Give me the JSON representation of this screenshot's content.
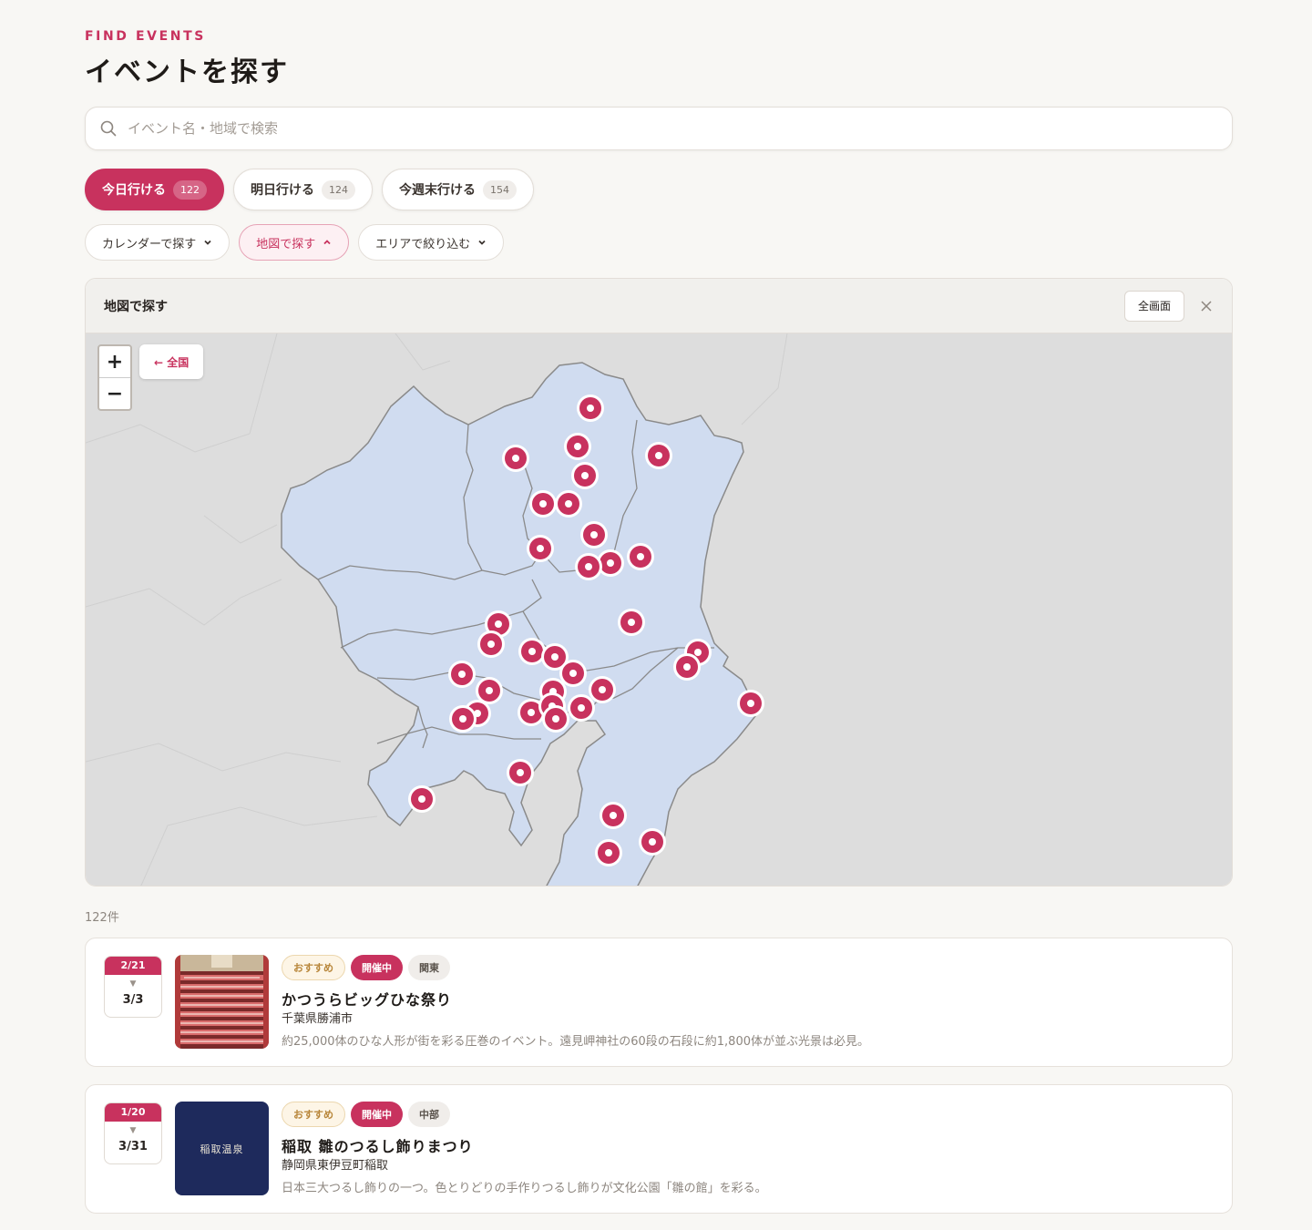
{
  "header": {
    "eyebrow": "FIND EVENTS",
    "title": "イベントを探す"
  },
  "search": {
    "placeholder": "イベント名・地域で検索",
    "icon": "search-icon"
  },
  "day_tabs": [
    {
      "label": "今日行ける",
      "count": "122",
      "active": true
    },
    {
      "label": "明日行ける",
      "count": "124",
      "active": false
    },
    {
      "label": "今週末行ける",
      "count": "154",
      "active": false
    }
  ],
  "filters": [
    {
      "label": "カレンダーで探す",
      "icon": "chevron-down-icon",
      "active": false
    },
    {
      "label": "地図で探す",
      "icon": "chevron-up-icon",
      "active": true
    },
    {
      "label": "エリアで絞り込む",
      "icon": "chevron-down-icon",
      "active": false
    }
  ],
  "map_panel": {
    "title": "地図で探す",
    "fullscreen_label": "全画面",
    "close_icon": "close-icon",
    "zoom_in": "+",
    "zoom_out": "−",
    "back_label": "← 全国"
  },
  "result_count": "122件",
  "events": [
    {
      "date_from": "2/21",
      "date_to": "3/3",
      "tags": [
        "おすすめ",
        "開催中",
        "関東"
      ],
      "title": "かつうらビッグひな祭り",
      "place": "千葉県勝浦市",
      "desc": "約25,000体のひな人形が街を彩る圧巻のイベント。遠見岬神社の60段の石段に約1,800体が並ぶ光景は必見。"
    },
    {
      "date_from": "1/20",
      "date_to": "3/31",
      "tags": [
        "おすすめ",
        "開催中",
        "中部"
      ],
      "title": "稲取 雛のつるし飾りまつり",
      "place": "静岡県東伊豆町稲取",
      "desc": "日本三大つるし飾りの一つ。色とりどりの手作りつるし飾りが文化公園「雛の館」を彩る。",
      "thumb_text": "稲取温泉"
    }
  ],
  "colors": {
    "accent": "#c8325e",
    "land": "#d0dcf0",
    "background": "#f8f7f4"
  }
}
